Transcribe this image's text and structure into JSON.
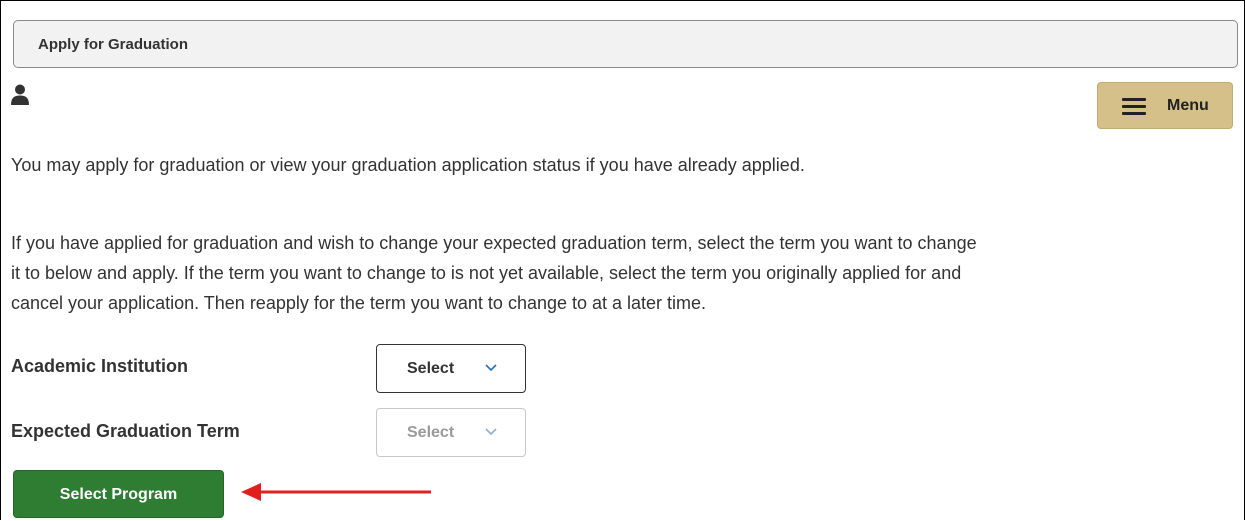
{
  "page": {
    "title": "Apply for Graduation"
  },
  "header": {
    "user_icon": "person-icon",
    "menu_label": "Menu",
    "menu_icon": "hamburger-icon"
  },
  "content": {
    "intro": "You may apply for graduation or view your graduation application status if you have already applied.",
    "instructions_lines": [
      "If you have applied for graduation and wish to change your expected graduation term, select the term you want to change",
      "it to below and apply. If the term you want to change to is not yet available, select the term you originally applied for and",
      "cancel your application. Then reapply for the term you want to change to at a later time."
    ]
  },
  "form": {
    "academic_institution": {
      "label": "Academic Institution",
      "selected": "Select",
      "enabled": true
    },
    "expected_graduation_term": {
      "label": "Expected Graduation Term",
      "selected": "Select",
      "enabled": false
    },
    "submit_label": "Select Program"
  },
  "colors": {
    "menu_button": "#d6c08a",
    "primary_button": "#2e7d32",
    "chevron": "#2a6ebb",
    "annotation_arrow": "#e02020",
    "header_background": "#f2f2f2"
  }
}
